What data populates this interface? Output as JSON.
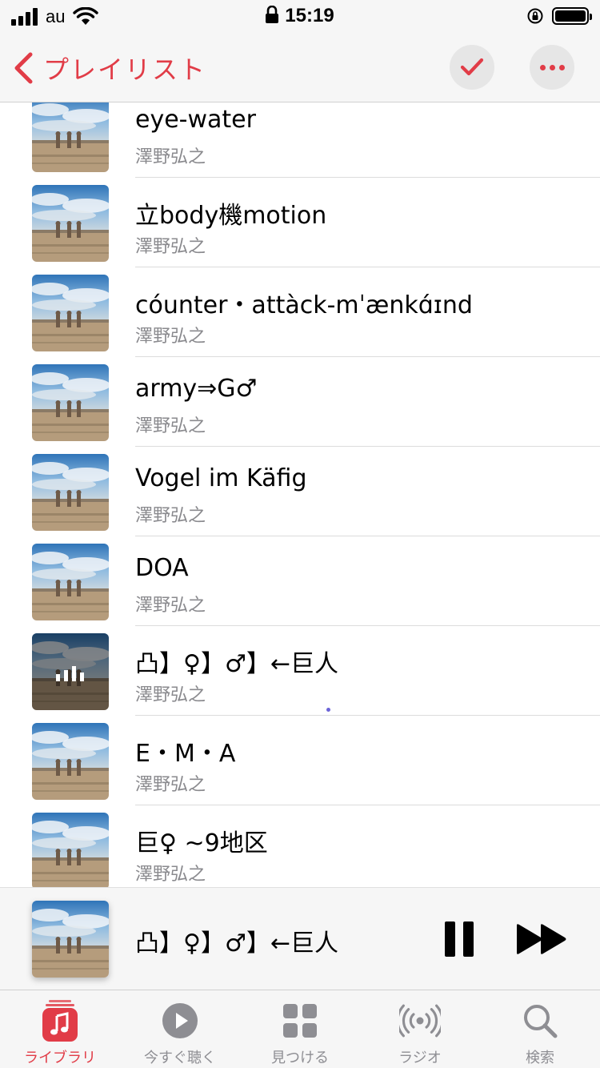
{
  "status_bar": {
    "carrier": "au",
    "time": "15:19"
  },
  "nav": {
    "back_label": "プレイリスト"
  },
  "colors": {
    "accent": "#e13c47",
    "secondary_text": "#8a8a8e"
  },
  "songs": [
    {
      "title": "eye-water",
      "artist": "澤野弘之",
      "playing": false
    },
    {
      "title": "立body機motion",
      "artist": "澤野弘之",
      "playing": false
    },
    {
      "title": "cóunter・attàck-mˈænkɑ́ɪnd",
      "artist": "澤野弘之",
      "playing": false
    },
    {
      "title": "army⇒G♂",
      "artist": "澤野弘之",
      "playing": false
    },
    {
      "title": "Vogel im Käfig",
      "artist": "澤野弘之",
      "playing": false
    },
    {
      "title": "DOA",
      "artist": "澤野弘之",
      "playing": false
    },
    {
      "title": "凸】♀】♂】←巨人",
      "artist": "澤野弘之",
      "playing": true
    },
    {
      "title": "E・M・A",
      "artist": "澤野弘之",
      "playing": false
    },
    {
      "title": "巨♀ ~9地区",
      "artist": "澤野弘之",
      "playing": false
    }
  ],
  "mini_player": {
    "title": "凸】♀】♂】←巨人"
  },
  "tabs": [
    {
      "label": "ライブラリ",
      "icon": "music-note-icon",
      "active": true
    },
    {
      "label": "今すぐ聴く",
      "icon": "play-circle-icon",
      "active": false
    },
    {
      "label": "見つける",
      "icon": "grid-icon",
      "active": false
    },
    {
      "label": "ラジオ",
      "icon": "radio-waves-icon",
      "active": false
    },
    {
      "label": "検索",
      "icon": "search-icon",
      "active": false
    }
  ]
}
